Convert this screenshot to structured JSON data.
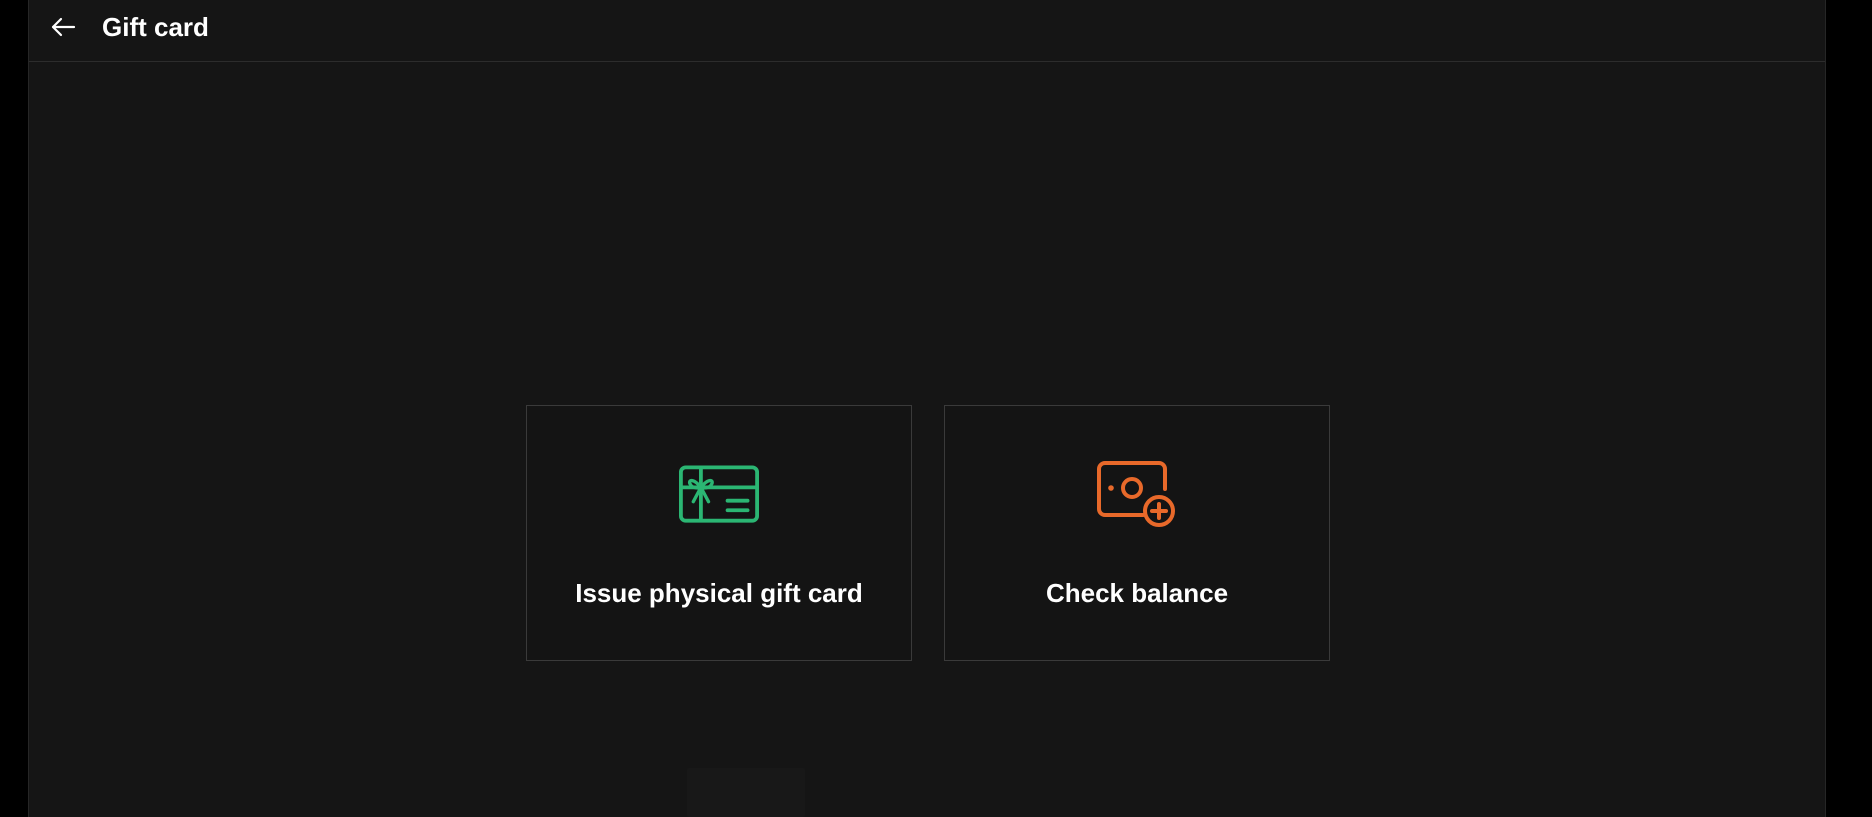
{
  "header": {
    "title": "Gift card",
    "back_icon": "arrow-left-icon"
  },
  "options": [
    {
      "label": "Issue physical gift card",
      "icon": "gift-card-icon",
      "icon_color": "#2bb673"
    },
    {
      "label": "Check balance",
      "icon": "balance-check-icon",
      "icon_color": "#e8692a"
    }
  ],
  "colors": {
    "background": "#151515",
    "card_border": "#3a3a3a",
    "text": "#ffffff"
  }
}
